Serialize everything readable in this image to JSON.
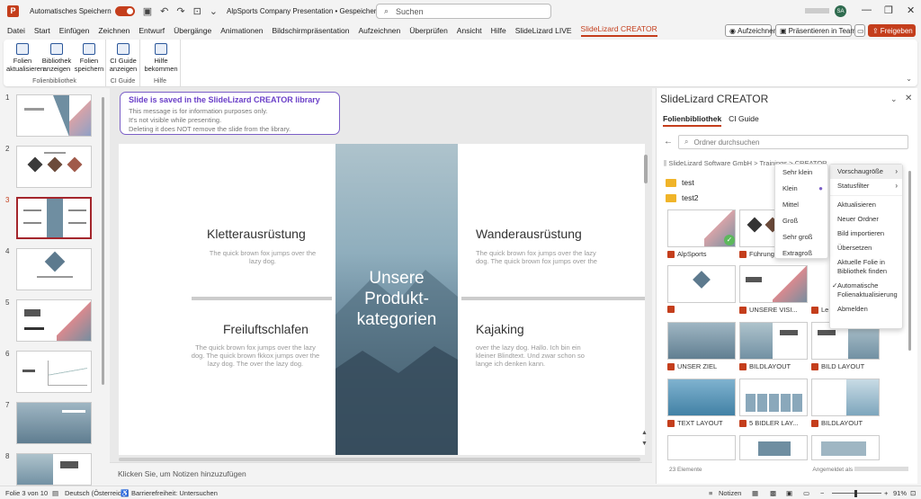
{
  "titlebar": {
    "autosave_label": "Automatisches Speichern",
    "doc_title": "AlpSports Company Presentation • Gespeichert",
    "search_placeholder": "Suchen",
    "user_initials": "SA"
  },
  "menu": [
    "Datei",
    "Start",
    "Einfügen",
    "Zeichnen",
    "Entwurf",
    "Übergänge",
    "Animationen",
    "Bildschirmpräsentation",
    "Aufzeichnen",
    "Überprüfen",
    "Ansicht",
    "Hilfe",
    "SlideLizard LIVE",
    "SlideLizard CREATOR"
  ],
  "menu_buttons": {
    "record": "Aufzeichnen",
    "teams": "Präsentieren in Teams",
    "share": "Freigeben"
  },
  "ribbon": {
    "groups": [
      {
        "label": "Folienbibliothek",
        "buttons": [
          "Folien aktualisieren",
          "Bibliothek anzeigen",
          "Folien speichern"
        ]
      },
      {
        "label": "CI Guide",
        "buttons": [
          "CI Guide anzeigen"
        ]
      },
      {
        "label": "Hilfe",
        "buttons": [
          "Hilfe bekommen"
        ]
      }
    ]
  },
  "thumbs": [
    "1",
    "2",
    "3",
    "4",
    "5",
    "6",
    "7",
    "8"
  ],
  "notice": {
    "title": "Slide is saved in the SlideLizard CREATOR library",
    "lines": [
      "This message is for information purposes only.",
      "It's not visible while presenting.",
      "Deleting it does NOT remove the slide from the library."
    ]
  },
  "slide": {
    "center_title": "Unsere Produkt-kategorien",
    "blocks": [
      {
        "heading": "Kletterausrüstung",
        "body": "The quick brown fox jumps over the lazy dog."
      },
      {
        "heading": "Wanderausrüstung",
        "body": "The quick brown fox jumps over the lazy dog. The quick brown fox jumps over the"
      },
      {
        "heading": "Freiluftschlafen",
        "body": "The quick brown fox jumps over the lazy dog. The quick brown fkkox jumps over the lazy dog. The over the lazy dog."
      },
      {
        "heading": "Kajaking",
        "body": "over the lazy dog. Hallo. Ich bin ein kleiner Blindtext. Und zwar schon so lange ich denken kann."
      }
    ]
  },
  "notes_placeholder": "Klicken Sie, um Notizen hinzuzufügen",
  "panel": {
    "title": "SlideLizard CREATOR",
    "tabs": [
      "Folienbibliothek",
      "CI Guide"
    ],
    "search_placeholder": "Ordner durchsuchen",
    "breadcrumb": "SlideLizard Software GmbH > Trainings > CREATOR",
    "folders": [
      "test",
      "test2"
    ],
    "tiles": [
      "AlpSports",
      "Führung",
      "",
      "",
      "UNSERE VISI...",
      "Le",
      "UNSER ZIEL",
      "BILDLAYOUT",
      "BILD LAYOUT",
      "TEXT LAYOUT",
      "5 BIDLER LAY...",
      "BILDLAYOUT"
    ],
    "count": "23 Elemente",
    "account": "Angemeldet als"
  },
  "menu_main": [
    "Vorschaugröße",
    "Statusfilter",
    "Aktualisieren",
    "Neuer Ordner",
    "Bild importieren",
    "Übersetzen",
    "Aktuelle Folie in Bibliothek finden",
    "Automatische Folienaktualisierung",
    "Abmelden"
  ],
  "menu_size": [
    "Sehr klein",
    "Klein",
    "Mittel",
    "Groß",
    "Sehr groß",
    "Extragroß"
  ],
  "status": {
    "slide_info": "Folie 3 von 10",
    "language": "Deutsch (Österreich)",
    "accessibility": "Barrierefreiheit: Untersuchen",
    "notes": "Notizen",
    "zoom": "91%"
  }
}
